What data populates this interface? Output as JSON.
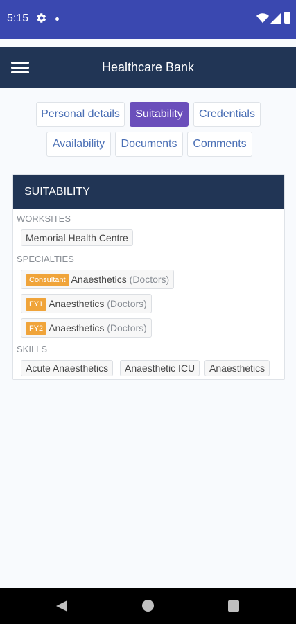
{
  "status_bar": {
    "time": "5:15"
  },
  "app_bar": {
    "title": "Healthcare Bank"
  },
  "tabs": [
    {
      "label": "Personal details",
      "active": false
    },
    {
      "label": "Suitability",
      "active": true
    },
    {
      "label": "Credentials",
      "active": false
    },
    {
      "label": "Availability",
      "active": false
    },
    {
      "label": "Documents",
      "active": false
    },
    {
      "label": "Comments",
      "active": false
    }
  ],
  "card": {
    "title": "SUITABILITY",
    "worksites": {
      "label": "WORKSITES",
      "items": [
        "Memorial Health Centre"
      ]
    },
    "specialties": {
      "label": "SPECIALTIES",
      "items": [
        {
          "badge": "Consultant",
          "name": "Anaesthetics",
          "category": "(Doctors)"
        },
        {
          "badge": "FY1",
          "name": "Anaesthetics",
          "category": "(Doctors)"
        },
        {
          "badge": "FY2",
          "name": "Anaesthetics",
          "category": "(Doctors)"
        }
      ]
    },
    "skills": {
      "label": "SKILLS",
      "items": [
        "Acute Anaesthetics",
        "Anaesthetic ICU",
        "Anaesthetics"
      ]
    }
  },
  "colors": {
    "status_bar": "#3a48b0",
    "app_bar": "#213555",
    "active_tab": "#6b4fbb",
    "tab_text": "#4a6fb5",
    "badge": "#f0a43a"
  },
  "icons": {
    "status": [
      "gear-icon",
      "notification-dot-icon",
      "wifi-icon",
      "signal-icon",
      "battery-icon"
    ],
    "app_bar": "hamburger-menu-icon",
    "nav": [
      "back-icon",
      "home-icon",
      "recents-icon"
    ]
  }
}
